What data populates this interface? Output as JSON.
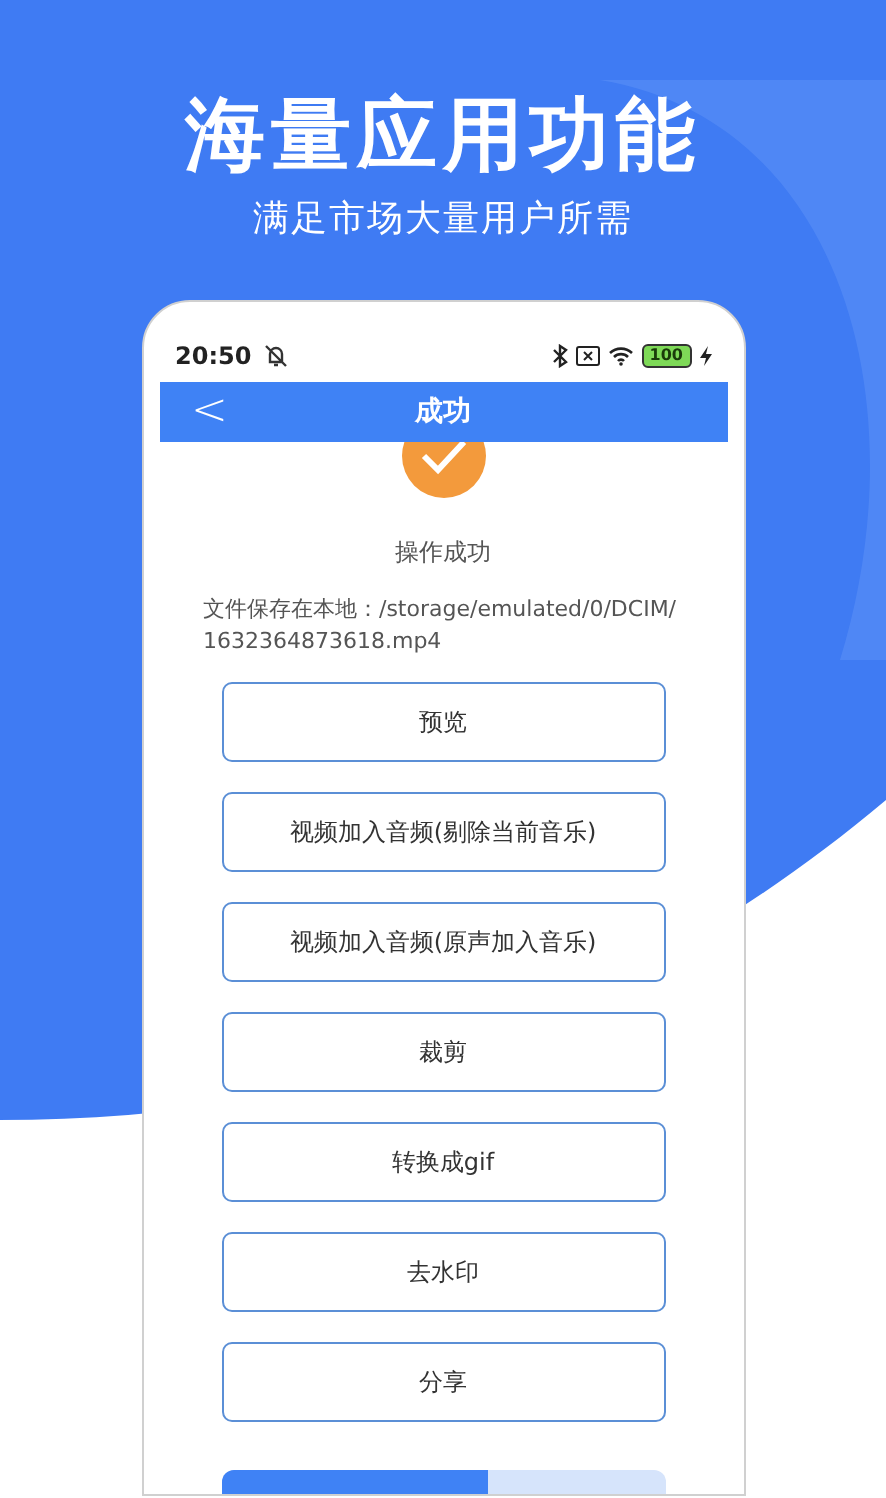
{
  "headline": "海量应用功能",
  "subheadline": "满足市场大量用户所需",
  "status_bar": {
    "time": "20:50",
    "battery": "100"
  },
  "app_bar": {
    "back": "<",
    "title": "成功"
  },
  "result": {
    "message": "操作成功",
    "path": "文件保存在本地：/storage/emulated/0/DCIM/1632364873618.mp4"
  },
  "buttons": [
    "预览",
    "视频加入音频(剔除当前音乐)",
    "视频加入音频(原声加入音乐)",
    "裁剪",
    "转换成gif",
    "去水印",
    "分享"
  ],
  "progress": {
    "level": 0.6
  }
}
